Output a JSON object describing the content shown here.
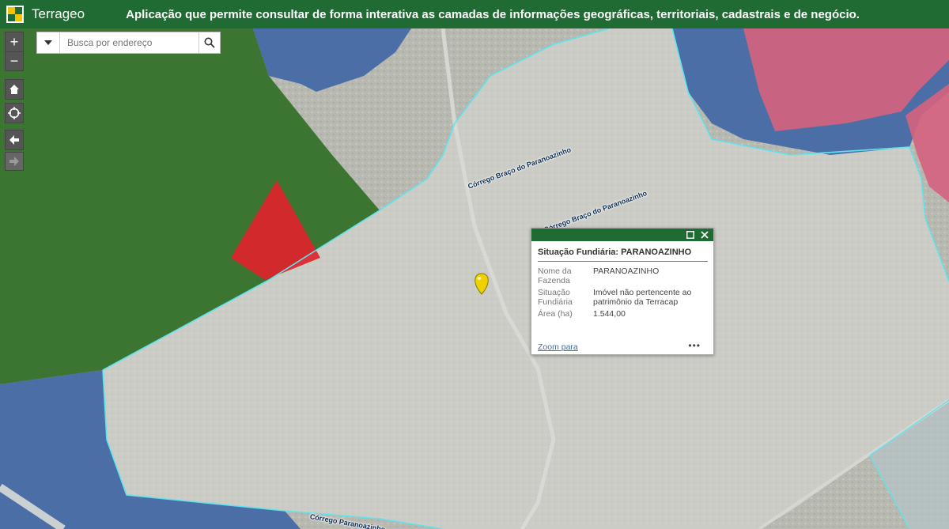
{
  "header": {
    "app_name": "Terrageo",
    "banner": "Aplicação que permite consultar de forma interativa as camadas de informações geográficas, territoriais, cadastrais e de negócio."
  },
  "map_controls": {
    "zoom_in": "+",
    "zoom_out": "−"
  },
  "search": {
    "placeholder": "Busca por endereço"
  },
  "map_labels": [
    "Córrego Braço do Paranoazinho",
    "Córrego Braço do Paranoazinho",
    "Córrego Paranoazinho"
  ],
  "popup": {
    "title": "Situação Fundiária: PARANOAZINHO",
    "rows": [
      {
        "key": "Nome da Fazenda",
        "value": "PARANOAZINHO"
      },
      {
        "key": "Situação Fundiária",
        "value": "Imóvel não pertencente ao patrimônio da Terracap"
      },
      {
        "key": "Área (ha)",
        "value": "1.544,00"
      }
    ],
    "zoom_link": "Zoom para",
    "more": "•••"
  },
  "colors": {
    "header": "#1f6b33",
    "green_area": "#2f6e25",
    "red_area": "#e0242b",
    "blue_area": "#3f66a6",
    "pink_area": "#d6627e",
    "boundary": "#5fe3ee",
    "marker": "#f0d000"
  }
}
